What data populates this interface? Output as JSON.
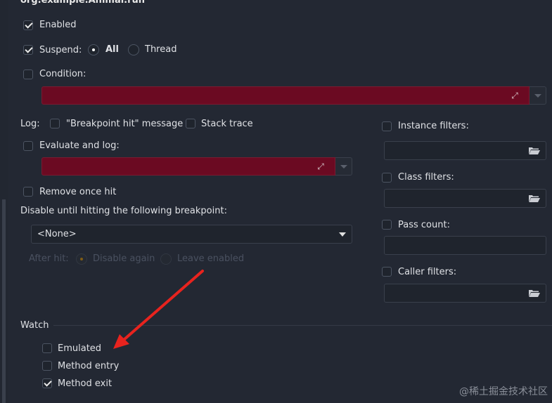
{
  "title": "org.example.Animal.run",
  "enabled": {
    "label": "Enabled",
    "checked": true
  },
  "suspend": {
    "label": "Suspend:",
    "checked": true,
    "options": [
      "All",
      "Thread"
    ],
    "selected": "All"
  },
  "condition": {
    "label": "Condition:",
    "checked": false
  },
  "log": {
    "label": "Log:",
    "breakpoint_hit": {
      "label": "\"Breakpoint hit\" message",
      "checked": false
    },
    "stack_trace": {
      "label": "Stack trace",
      "checked": false
    }
  },
  "evaluate": {
    "label": "Evaluate and log:",
    "checked": false
  },
  "remove_once_hit": {
    "label": "Remove once hit",
    "checked": false
  },
  "disable_until": {
    "label": "Disable until hitting the following breakpoint:",
    "value": "<None>"
  },
  "after_hit": {
    "label": "After hit:",
    "options": [
      "Disable again",
      "Leave enabled"
    ],
    "selected": "Disable again"
  },
  "filters": {
    "instance": {
      "label": "Instance filters:",
      "checked": false
    },
    "class": {
      "label": "Class filters:",
      "checked": false
    },
    "pass_count": {
      "label": "Pass count:",
      "checked": false
    },
    "caller": {
      "label": "Caller filters:",
      "checked": false
    }
  },
  "watch": {
    "label": "Watch",
    "emulated": {
      "label": "Emulated",
      "checked": false
    },
    "method_entry": {
      "label": "Method entry",
      "checked": false
    },
    "method_exit": {
      "label": "Method exit",
      "checked": true
    }
  },
  "watermark": "@稀土掘金技术社区",
  "colors": {
    "background": "#232833",
    "error_field": "#6b0a22",
    "annotation_arrow": "#e8231e"
  }
}
